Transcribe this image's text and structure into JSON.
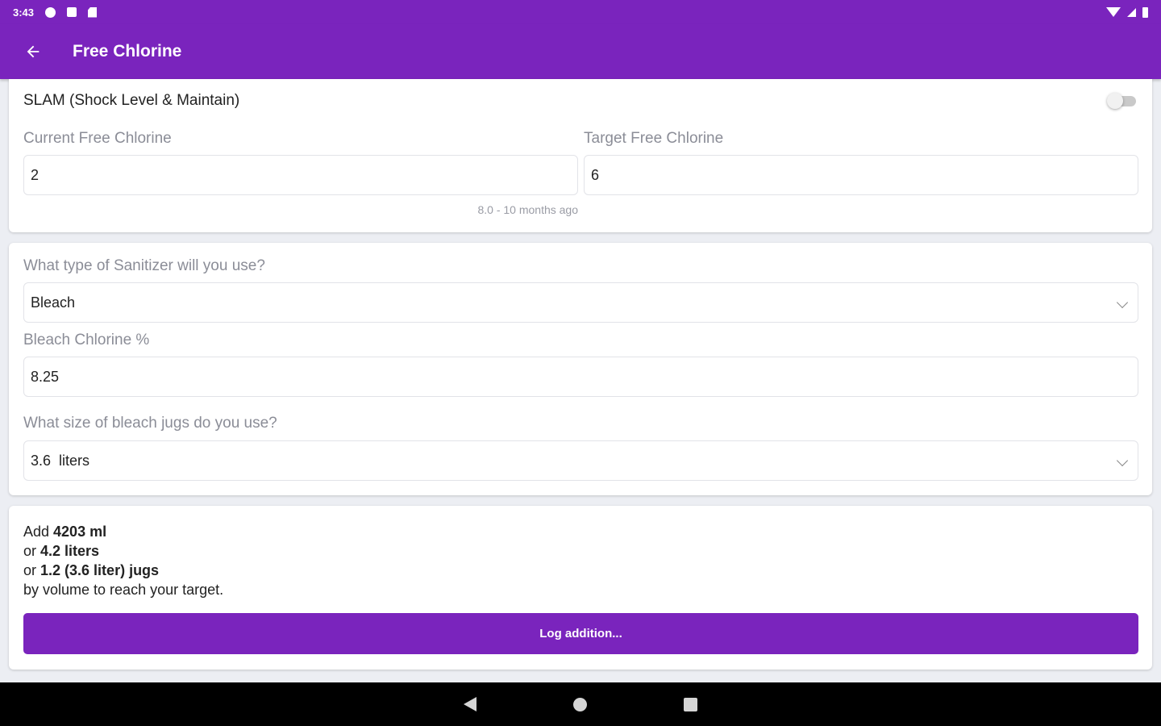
{
  "status_bar": {
    "time": "3:43",
    "left_icons": [
      "gear-icon",
      "media-icon",
      "sd-card-icon"
    ],
    "right_icons": [
      "wifi-icon",
      "signal-icon",
      "battery-icon"
    ]
  },
  "app_bar": {
    "title": "Free Chlorine",
    "back_icon": "arrow-left-icon",
    "color": "#7a24bd"
  },
  "chlorine_card": {
    "slam_label": "SLAM (Shock Level & Maintain)",
    "slam_enabled": false,
    "current": {
      "label": "Current Free Chlorine",
      "value": "2"
    },
    "target": {
      "label": "Target Free Chlorine",
      "value": "6"
    },
    "hint": "8.0 - 10 months ago"
  },
  "sanitizer_card": {
    "type_label": "What type of Sanitizer will you use?",
    "type_value": "Bleach",
    "percent_label": "Bleach Chlorine %",
    "percent_value": "8.25",
    "jug_label": "What size of bleach jugs do you use?",
    "jug_value": "3.6  liters"
  },
  "result_card": {
    "line1_prefix": "Add ",
    "line1_amount": "4203 ml",
    "line2_prefix": "or ",
    "line2_amount": "4.2 liters",
    "line3_prefix": "or ",
    "line3_amount": "1.2 (3.6 liter) jugs",
    "line4": "by volume to reach your target.",
    "button_label": "Log addition..."
  },
  "nav_bar": {
    "icons": [
      "nav-back-icon",
      "nav-home-icon",
      "nav-recents-icon"
    ]
  }
}
